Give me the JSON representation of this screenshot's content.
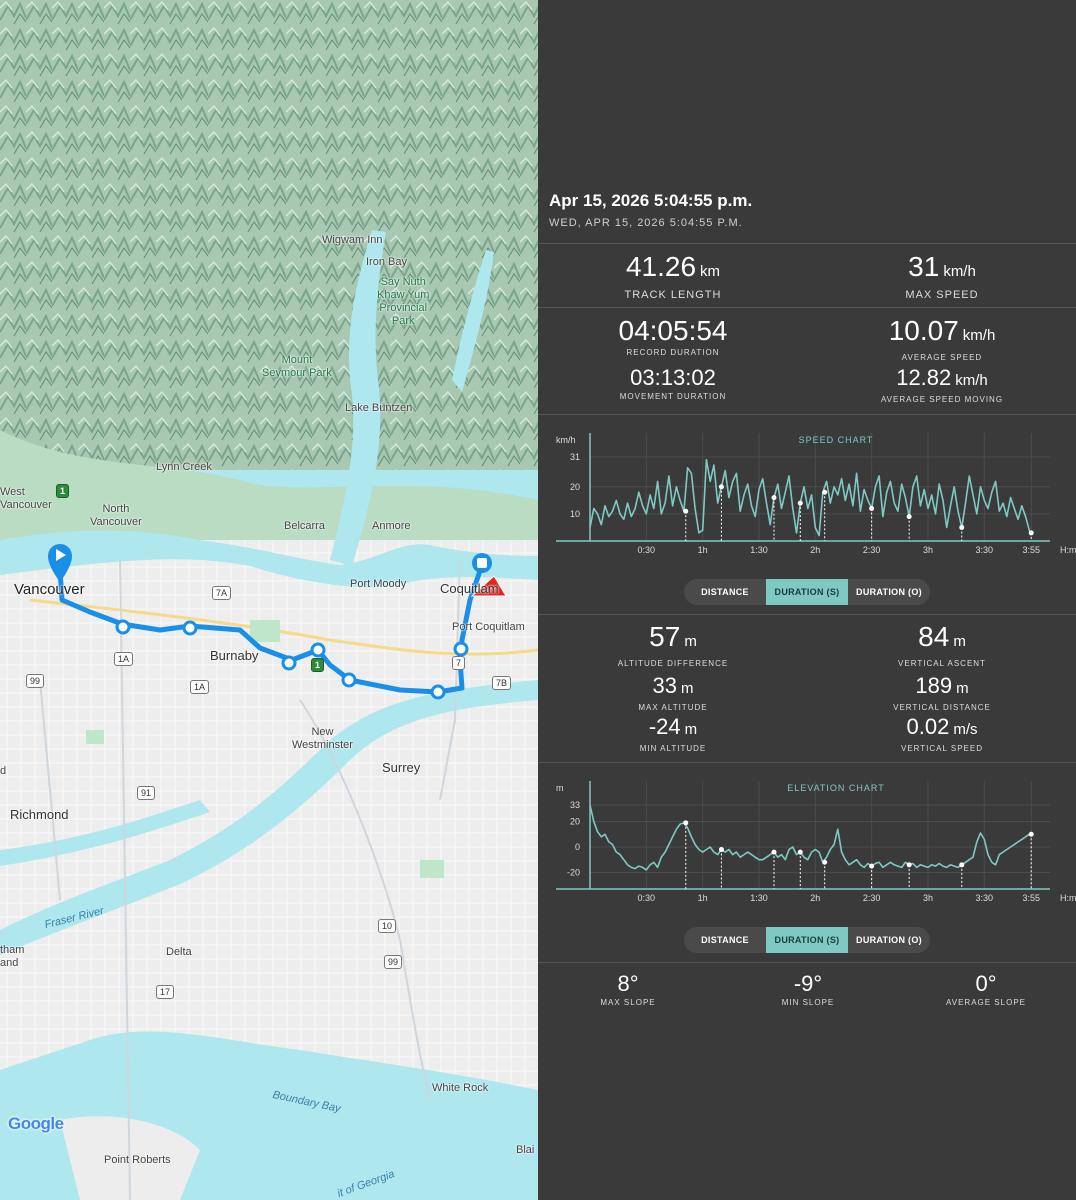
{
  "map": {
    "labels": {
      "wigwam": "Wigwam Inn",
      "iron_bay": "Iron Bay",
      "park1": "Say Nuth\nKhaw Yum\nProvincial\nPark",
      "mount_seymour": "Mount\nSeymour Park",
      "lake_buntzen": "Lake Buntzen",
      "lynn_creek": "Lynn Creek",
      "west_vancouver": "West\nVancouver",
      "north_vancouver": "North\nVancouver",
      "belcarra": "Belcarra",
      "anmore": "Anmore",
      "vancouver": "Vancouver",
      "port_moody": "Port Moody",
      "coquitlam": "Coquitlam",
      "port_coquitlam": "Port Coquitlam",
      "burnaby": "Burnaby",
      "new_westminster": "New\nWestminster",
      "surrey": "Surrey",
      "richmond": "Richmond",
      "fraser_river": "Fraser River",
      "delta": "Delta",
      "tham": "tham\nand",
      "white_rock": "White Rock",
      "boundary_bay": "Boundary Bay",
      "point_roberts": "Point Roberts",
      "georgia": "it of Georgia",
      "blaine": "Blai",
      "d": "d"
    },
    "shields": {
      "s7a": "7A",
      "s1a_a": "1A",
      "s1a_b": "1A",
      "s99_a": "99",
      "s91": "91",
      "s10": "10",
      "s99_b": "99",
      "s17": "17",
      "s7": "7",
      "s7b": "7B",
      "s1_a": "1",
      "s1_b": "1"
    },
    "logo": "Google",
    "route_color": "#1a8fe8",
    "accent_color": "#7fc9c4"
  },
  "header": {
    "title": "Apr 15, 2026 5:04:55 p.m.",
    "subtitle": "WED, APR 15, 2026 5:04:55 P.M."
  },
  "stats1": {
    "track_length": {
      "value": "41.26",
      "unit": "km",
      "label": "TRACK LENGTH"
    },
    "max_speed": {
      "value": "31",
      "unit": "km/h",
      "label": "MAX SPEED"
    },
    "record_duration": {
      "value": "04:05:54",
      "label": "RECORD DURATION"
    },
    "average_speed": {
      "value": "10.07",
      "unit": "km/h",
      "label": "AVERAGE SPEED"
    },
    "movement_duration": {
      "value": "03:13:02",
      "label": "MOVEMENT DURATION"
    },
    "average_speed_moving": {
      "value": "12.82",
      "unit": "km/h",
      "label": "AVERAGE SPEED MOVING"
    }
  },
  "speed_toggle": {
    "distance": "DISTANCE",
    "duration_s": "DURATION (S)",
    "duration_o": "DURATION (O)"
  },
  "stats2": {
    "altitude_difference": {
      "value": "57",
      "unit": "m",
      "label": "ALTITUDE DIFFERENCE"
    },
    "vertical_ascent": {
      "value": "84",
      "unit": "m",
      "label": "VERTICAL ASCENT"
    },
    "max_altitude": {
      "value": "33",
      "unit": "m",
      "label": "MAX ALTITUDE"
    },
    "vertical_distance": {
      "value": "189",
      "unit": "m",
      "label": "VERTICAL DISTANCE"
    },
    "min_altitude": {
      "value": "-24",
      "unit": "m",
      "label": "MIN ALTITUDE"
    },
    "vertical_speed": {
      "value": "0.02",
      "unit": "m/s",
      "label": "VERTICAL SPEED"
    }
  },
  "elev_toggle": {
    "distance": "DISTANCE",
    "duration_s": "DURATION (S)",
    "duration_o": "DURATION (O)"
  },
  "slopes": {
    "max_slope": {
      "value": "8°",
      "label": "MAX SLOPE"
    },
    "min_slope": {
      "value": "-9°",
      "label": "MIN SLOPE"
    },
    "average_slope": {
      "value": "0°",
      "label": "AVERAGE SLOPE"
    }
  },
  "chart_data": [
    {
      "type": "line",
      "title": "SPEED CHART",
      "ylabel": "km/h",
      "xlabel": "H:m",
      "color": "#7fc9c4",
      "ylim": [
        0,
        31
      ],
      "xlim": [
        0,
        245
      ],
      "yticks": [
        10,
        20,
        31
      ],
      "xticks": [
        {
          "label": "0:30",
          "v": 30
        },
        {
          "label": "1h",
          "v": 60
        },
        {
          "label": "1:30",
          "v": 90
        },
        {
          "label": "2h",
          "v": 120
        },
        {
          "label": "2:30",
          "v": 150
        },
        {
          "label": "3h",
          "v": 180
        },
        {
          "label": "3:30",
          "v": 210
        },
        {
          "label": "3:55",
          "v": 235
        }
      ],
      "markers": [
        51,
        70,
        98,
        112,
        125,
        150,
        170,
        198,
        235
      ],
      "x": [
        0,
        2,
        4,
        6,
        8,
        10,
        12,
        14,
        16,
        18,
        20,
        22,
        24,
        26,
        28,
        30,
        32,
        34,
        36,
        38,
        40,
        42,
        44,
        46,
        48,
        50,
        52,
        54,
        56,
        58,
        60,
        62,
        64,
        66,
        68,
        70,
        72,
        74,
        76,
        78,
        80,
        82,
        84,
        86,
        88,
        90,
        92,
        94,
        96,
        98,
        100,
        102,
        104,
        106,
        108,
        110,
        112,
        114,
        116,
        118,
        120,
        122,
        124,
        126,
        128,
        130,
        132,
        134,
        136,
        138,
        140,
        142,
        144,
        146,
        148,
        150,
        152,
        154,
        156,
        158,
        160,
        162,
        164,
        166,
        168,
        170,
        172,
        174,
        176,
        178,
        180,
        182,
        184,
        186,
        188,
        190,
        192,
        194,
        196,
        198,
        200,
        202,
        204,
        206,
        208,
        210,
        212,
        214,
        216,
        218,
        220,
        222,
        224,
        226,
        228,
        230,
        232,
        234,
        235
      ],
      "y": [
        5,
        12,
        10,
        6,
        13,
        9,
        11,
        15,
        10,
        8,
        14,
        9,
        12,
        18,
        13,
        10,
        17,
        12,
        22,
        10,
        14,
        24,
        13,
        20,
        15,
        11,
        27,
        25,
        12,
        3,
        4,
        30,
        22,
        28,
        14,
        20,
        26,
        16,
        22,
        25,
        11,
        17,
        21,
        13,
        9,
        19,
        23,
        14,
        6,
        16,
        21,
        12,
        18,
        24,
        12,
        3,
        14,
        20,
        12,
        17,
        5,
        2,
        18,
        22,
        14,
        20,
        17,
        23,
        15,
        21,
        13,
        25,
        11,
        19,
        15,
        12,
        20,
        24,
        9,
        18,
        22,
        14,
        11,
        21,
        16,
        9,
        20,
        24,
        13,
        19,
        12,
        17,
        10,
        21,
        15,
        5,
        13,
        20,
        11,
        5,
        14,
        24,
        17,
        10,
        20,
        15,
        12,
        18,
        22,
        11,
        14,
        9,
        16,
        12,
        8,
        13,
        9,
        4,
        3
      ]
    },
    {
      "type": "line",
      "title": "ELEVATION CHART",
      "ylabel": "m",
      "xlabel": "H:m",
      "color": "#7fc9c4",
      "ylim": [
        -33,
        33
      ],
      "xlim": [
        0,
        245
      ],
      "yticks": [
        -20,
        0,
        20,
        33
      ],
      "xticks": [
        {
          "label": "0:30",
          "v": 30
        },
        {
          "label": "1h",
          "v": 60
        },
        {
          "label": "1:30",
          "v": 90
        },
        {
          "label": "2h",
          "v": 120
        },
        {
          "label": "2:30",
          "v": 150
        },
        {
          "label": "3h",
          "v": 180
        },
        {
          "label": "3:30",
          "v": 210
        },
        {
          "label": "3:55",
          "v": 235
        }
      ],
      "markers": [
        51,
        70,
        98,
        112,
        125,
        150,
        170,
        198,
        235
      ],
      "x": [
        0,
        2,
        4,
        6,
        8,
        10,
        12,
        14,
        16,
        18,
        20,
        22,
        24,
        26,
        28,
        30,
        32,
        34,
        36,
        38,
        40,
        42,
        44,
        46,
        48,
        50,
        52,
        54,
        56,
        58,
        60,
        62,
        64,
        66,
        68,
        70,
        72,
        74,
        76,
        78,
        80,
        82,
        84,
        86,
        88,
        90,
        92,
        94,
        96,
        98,
        100,
        102,
        104,
        106,
        108,
        110,
        112,
        114,
        116,
        118,
        120,
        122,
        124,
        126,
        128,
        130,
        132,
        134,
        136,
        138,
        140,
        142,
        144,
        146,
        148,
        150,
        152,
        154,
        156,
        158,
        160,
        162,
        164,
        166,
        168,
        170,
        172,
        174,
        176,
        178,
        180,
        182,
        184,
        186,
        188,
        190,
        192,
        194,
        196,
        198,
        200,
        202,
        204,
        206,
        208,
        210,
        212,
        214,
        216,
        218,
        220,
        222,
        224,
        226,
        228,
        230,
        232,
        234,
        235
      ],
      "y": [
        33,
        20,
        12,
        8,
        10,
        4,
        2,
        -4,
        -6,
        -10,
        -14,
        -16,
        -17,
        -15,
        -16,
        -18,
        -14,
        -12,
        -16,
        -8,
        -4,
        2,
        8,
        14,
        18,
        19,
        15,
        8,
        2,
        -2,
        -4,
        -2,
        0,
        -4,
        -6,
        -2,
        -4,
        -2,
        -6,
        -4,
        -8,
        -6,
        -4,
        -6,
        -8,
        -10,
        -10,
        -8,
        -6,
        -4,
        -8,
        -6,
        -10,
        -2,
        0,
        -6,
        -4,
        -8,
        -10,
        -4,
        -2,
        -4,
        -12,
        -8,
        -2,
        2,
        14,
        -4,
        -10,
        -14,
        -12,
        -10,
        -14,
        -16,
        -13,
        -15,
        -13,
        -12,
        -16,
        -14,
        -12,
        -14,
        -15,
        -16,
        -12,
        -14,
        -13,
        -16,
        -14,
        -15,
        -16,
        -14,
        -15,
        -13,
        -15,
        -16,
        -14,
        -15,
        -16,
        -14,
        -12,
        -10,
        -8,
        4,
        11,
        6,
        -6,
        -12,
        -14,
        -6,
        -4,
        -2,
        0,
        2,
        4,
        6,
        8,
        10,
        10
      ]
    }
  ]
}
